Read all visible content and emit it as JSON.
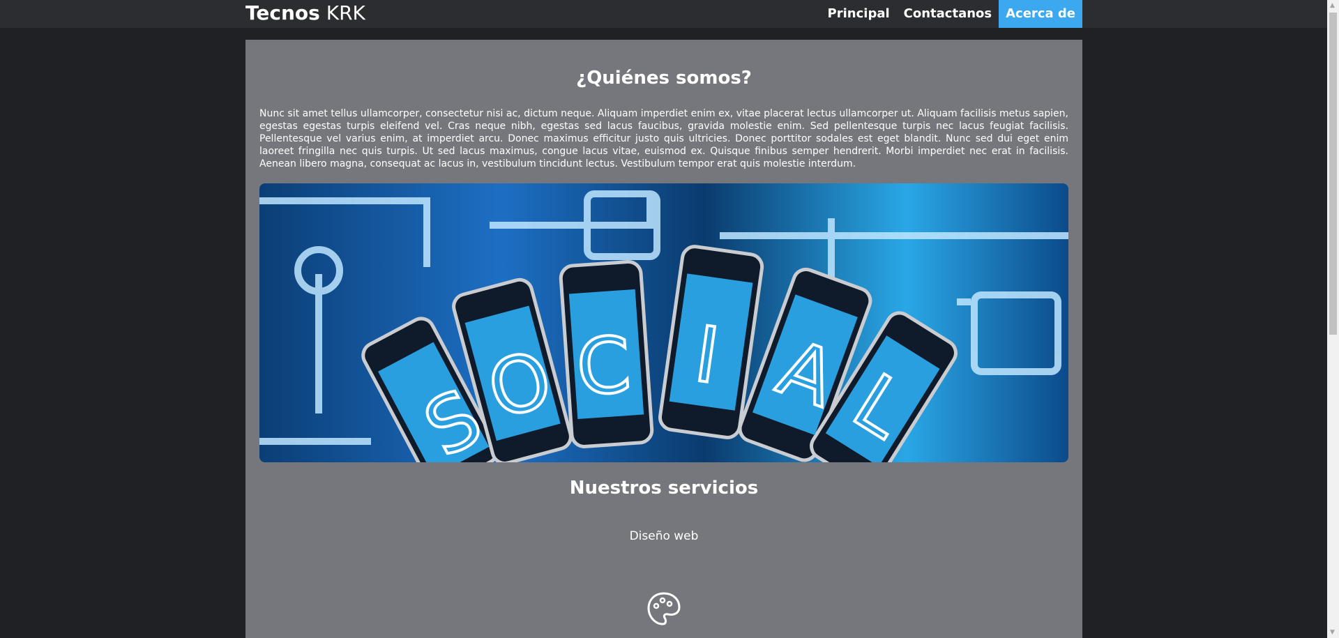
{
  "navbar": {
    "brand_bold": "Tecnos",
    "brand_light": "KRK",
    "links": [
      "Principal",
      "Contactanos",
      "Acerca de"
    ],
    "active": "Acerca de"
  },
  "about": {
    "title": "¿Quiénes somos?",
    "text": "Nunc sit amet tellus ullamcorper, consectetur nisi ac, dictum neque. Aliquam imperdiet enim ex, vitae placerat lectus ullamcorper ut. Aliquam facilisis metus sapien, egestas egestas turpis eleifend vel. Cras neque nibh, egestas sed lacus faucibus, gravida molestie enim. Sed pellentesque turpis nec lacus feugiat facilisis. Pellentesque vel varius enim, at imperdiet arcu. Donec maximus efficitur justo quis ultricies. Donec porttitor sodales est eget blandit. Nunc sed dui eget enim laoreet fringilla nec quis turpis. Ut sed lacus maximus, congue lacus vitae, euismod ex. Quisque finibus semper hendrerit. Morbi imperdiet nec erat in facilisis. Aenean libero magna, consequat ac lacus in, vestibulum tincidunt lectus. Vestibulum tempor erat quis molestie interdum.",
    "image_letters": [
      "S",
      "O",
      "C",
      "I",
      "A",
      "L"
    ]
  },
  "services": {
    "title": "Nuestros servicios",
    "items": [
      {
        "label": "Diseño web",
        "icon": "palette-icon"
      }
    ]
  },
  "colors": {
    "accent": "#3ba8f0",
    "card": "#75777c",
    "nav": "#2c2d31",
    "page": "#202124"
  }
}
